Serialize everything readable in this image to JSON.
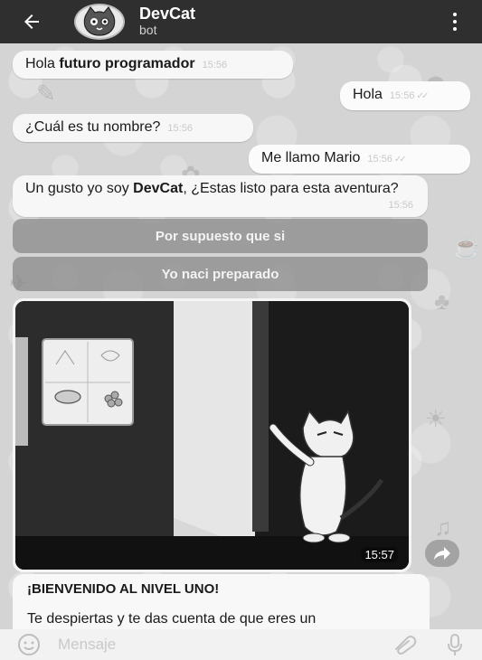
{
  "header": {
    "title": "DevCat",
    "subtitle": "bot"
  },
  "messages": [
    {
      "dir": "in",
      "text_pre": "Hola ",
      "text_bold": "futuro programador",
      "time": "15:56"
    },
    {
      "dir": "out",
      "text": "Hola",
      "time": "15:56"
    },
    {
      "dir": "in",
      "text": "¿Cuál es tu nombre?",
      "time": "15:56"
    },
    {
      "dir": "out",
      "text": "Me llamo Mario",
      "time": "15:56"
    },
    {
      "dir": "in",
      "text_pre": "Un gusto yo soy ",
      "text_bold": "DevCat",
      "text_post": ", ¿Estas listo para esta aventura?",
      "time": "15:56"
    }
  ],
  "bot_buttons": [
    "Por supuesto que si",
    "Yo naci preparado"
  ],
  "image_message": {
    "time": "15:57"
  },
  "text_message": {
    "title": "¡BIENVENIDO AL NIVEL UNO!",
    "body": "Te despiertas y te das cuenta de que eres un"
  },
  "input": {
    "placeholder": "Mensaje"
  }
}
